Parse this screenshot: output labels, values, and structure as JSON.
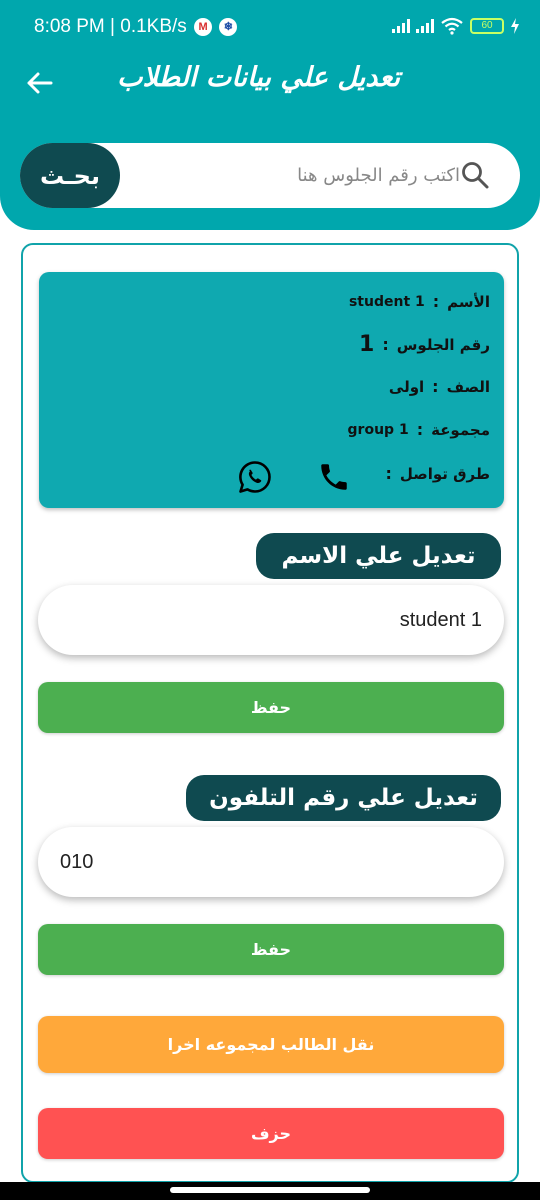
{
  "status_bar": {
    "time": "8:08 PM | 0.1KB/s",
    "app_badge_1": "M",
    "app_badge_2": "❄",
    "battery": "60"
  },
  "header": {
    "title": "تعديل علي بيانات الطلاب"
  },
  "search": {
    "placeholder": "اكتب رقم الجلوس هنا",
    "button_label": "بحـث"
  },
  "student": {
    "name_label": "الأسم",
    "name_value": "student 1",
    "seat_label": "رقم الجلوس",
    "seat_value": "1",
    "class_label": "الصف",
    "class_value": "اولى",
    "group_label": "مجموعة",
    "group_value": "group 1",
    "contact_label": "طرق تواصل",
    "separator": ":"
  },
  "edit_name": {
    "heading": "تعديل علي الاسم",
    "value": "student 1",
    "save_label": "حفظ"
  },
  "edit_phone": {
    "heading": "تعديل علي رقم التلفون",
    "value": "010",
    "save_label": "حفظ"
  },
  "actions": {
    "move_label": "نقل الطالب لمجموعه اخرا",
    "delete_label": "حزف"
  },
  "colors": {
    "primary": "#00a7ad",
    "dark": "#0f4a50",
    "save": "#4caf50",
    "move": "#ffa83a",
    "delete": "#ff5252"
  }
}
